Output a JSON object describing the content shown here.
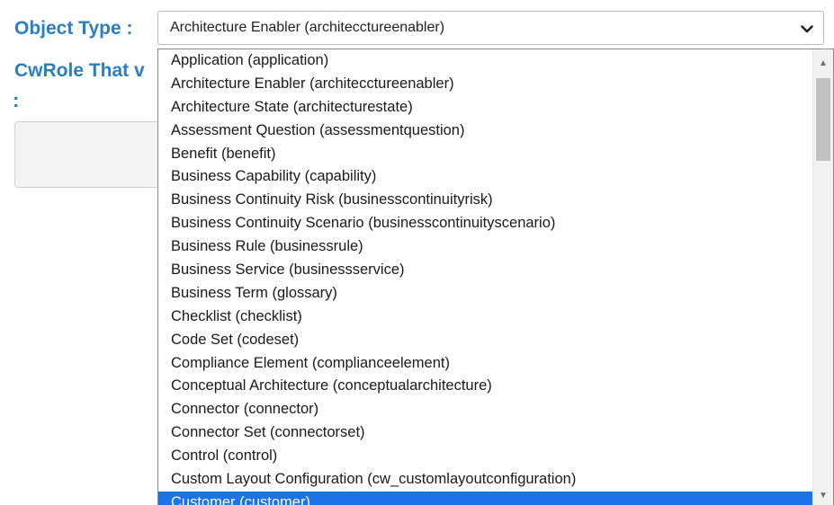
{
  "form": {
    "object_type_label": "Object Type :",
    "cwrole_label": "CwRole That v",
    "cwrole_label_colon": ":"
  },
  "select": {
    "value": "Architecture Enabler (architecctureenabler)",
    "chevron_icon": "chevron-down-icon"
  },
  "dropdown": {
    "options": [
      "Application (application)",
      "Architecture Enabler (architecctureenabler)",
      "Architecture State (architecturestate)",
      "Assessment Question (assessmentquestion)",
      "Benefit (benefit)",
      "Business Capability (capability)",
      "Business Continuity Risk (businesscontinuityrisk)",
      "Business Continuity Scenario (businesscontinuityscenario)",
      "Business Rule (businessrule)",
      "Business Service (businessservice)",
      "Business Term (glossary)",
      "Checklist (checklist)",
      "Code Set (codeset)",
      "Compliance Element (complianceelement)",
      "Conceptual Architecture (conceptualarchitecture)",
      "Connector (connector)",
      "Connector Set (connectorset)",
      "Control (control)",
      "Custom Layout Configuration (cw_customlayoutconfiguration)",
      "Customer (customer)"
    ],
    "highlighted_option": "Customer (customer)",
    "highlight_color": "#1a73e8"
  },
  "colors": {
    "label": "#2a7fc4"
  }
}
